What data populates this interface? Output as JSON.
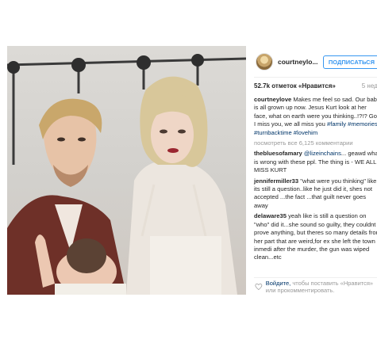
{
  "post": {
    "username": "courtneylo...",
    "follow_label": "ПОДПИСАТЬСЯ",
    "likes": "52.7k отметок «Нравится»",
    "age": "5 нед.",
    "caption": {
      "author": "courtneylove",
      "text": "Makes me feel so sad. Our baby is all grown up now. Jesus Kurt look at her face, what on earth were you thinking..!?!? God I miss you, we all miss you",
      "hashtags": "#family #memories #turnbacktime #lovehim"
    },
    "view_more": "посмотреть все 6,125 комментарии",
    "comments": [
      {
        "author": "thebluesofamary",
        "mention": "@lizeinchains",
        "text": "... geawd what is wrong with these ppl. The thing is - WE ALL MISS KURT"
      },
      {
        "author": "jennifermiller33",
        "text": "\"what were you thinking\" like its still a question..like he just did it, shes not accepted ...the fact ...that guilt never goes away"
      },
      {
        "author": "delaware35",
        "text": "yeah like is still a question on \"who\" did it...she sound so guilty, they couldnt prove anything, but theres so many details from her part that are weird,for ex she left the town inmedi after the murder, the gun was wiped clean...etc"
      }
    ],
    "login_prompt": {
      "link": "Войдите,",
      "text": "чтобы поставить «Нравится» или прокомментировать."
    }
  },
  "icons": {
    "heart": "heart-icon",
    "avatar": "avatar"
  },
  "colors": {
    "link_blue": "#003569",
    "follow_blue": "#3897f0",
    "muted": "#999999"
  }
}
